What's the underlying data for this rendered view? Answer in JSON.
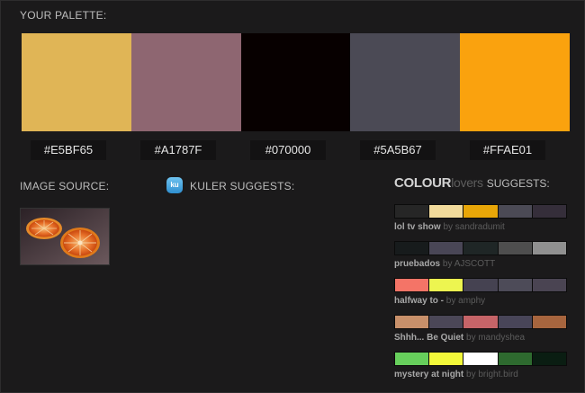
{
  "palette": {
    "title": "YOUR PALETTE:",
    "swatches": [
      {
        "hex_label": "#E5BF65",
        "color": "#E0B556"
      },
      {
        "hex_label": "#A1787F",
        "color": "#8E6671"
      },
      {
        "hex_label": "#070000",
        "color": "#070000"
      },
      {
        "hex_label": "#5A5B67",
        "color": "#4B4A55"
      },
      {
        "hex_label": "#FFAE01",
        "color": "#FAA20E"
      }
    ]
  },
  "image_source": {
    "title": "IMAGE SOURCE:"
  },
  "kuler": {
    "badge": "ku",
    "title": "KULER SUGGESTS:"
  },
  "colourlovers": {
    "brand_bold": "COLOUR",
    "brand_light": "lovers",
    "suffix": "SUGGESTS:",
    "suggestions": [
      {
        "name": "lol tv show",
        "by": "by sandradumit",
        "colors": [
          "#262626",
          "#F1DA9B",
          "#E8A608",
          "#4B4A55",
          "#352E3A"
        ]
      },
      {
        "name": "pruebados",
        "by": "by AJSCOTT",
        "colors": [
          "#171B1C",
          "#494656",
          "#1F2626",
          "#4E4E4E",
          "#909090"
        ]
      },
      {
        "name": "halfway to -",
        "by": "by amphy",
        "colors": [
          "#F47467",
          "#EDF550",
          "#454251",
          "#4D4B58",
          "#4A4452"
        ]
      },
      {
        "name": "Shhh... Be Quiet",
        "by": "by mandyshea",
        "colors": [
          "#C8906A",
          "#4B4757",
          "#C66468",
          "#484558",
          "#A7653E"
        ]
      },
      {
        "name": "mystery at night",
        "by": "by bright.bird",
        "colors": [
          "#67CF5C",
          "#F2F83A",
          "#FFFFFF",
          "#2E6A2F",
          "#0A1D12"
        ]
      }
    ]
  }
}
